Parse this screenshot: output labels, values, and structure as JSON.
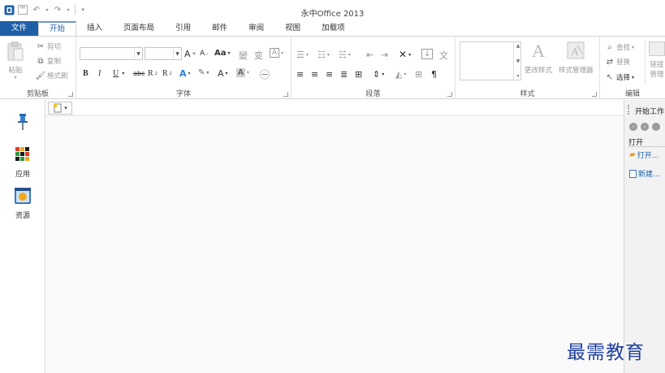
{
  "window": {
    "title": "永中Office 2013"
  },
  "tabs": [
    "文件",
    "开始",
    "插入",
    "页面布局",
    "引用",
    "邮件",
    "审阅",
    "视图",
    "加载项"
  ],
  "active_tab": "开始",
  "clipboard": {
    "label": "剪贴板",
    "paste": "粘贴",
    "cut": "剪切",
    "copy": "复制",
    "format_painter": "格式刷"
  },
  "font": {
    "label": "字体",
    "name_value": "",
    "size_value": "",
    "case_btn": "Aa",
    "bold": "B",
    "italic": "I",
    "underline": "U",
    "strike": "abc"
  },
  "paragraph": {
    "label": "段落"
  },
  "styles": {
    "label": "样式",
    "change_styles": "更改样式",
    "style_manager": "样式管理器"
  },
  "editing": {
    "label": "编辑",
    "find": "查找",
    "replace": "替换",
    "select": "选择",
    "link": "链接",
    "manage": "管理"
  },
  "sidebar": {
    "apps": "应用",
    "resources": "资源"
  },
  "taskpane": {
    "title": "开始工作",
    "open_label": "打开",
    "open_link": "打开...",
    "new_link": "新建..."
  },
  "watermark": "最需教育",
  "colors": {
    "file_tab": "#1f5fa8",
    "accent": "#1f5fa8",
    "watermark": "#1f3fa0",
    "doc_bg": "#fafafa"
  }
}
